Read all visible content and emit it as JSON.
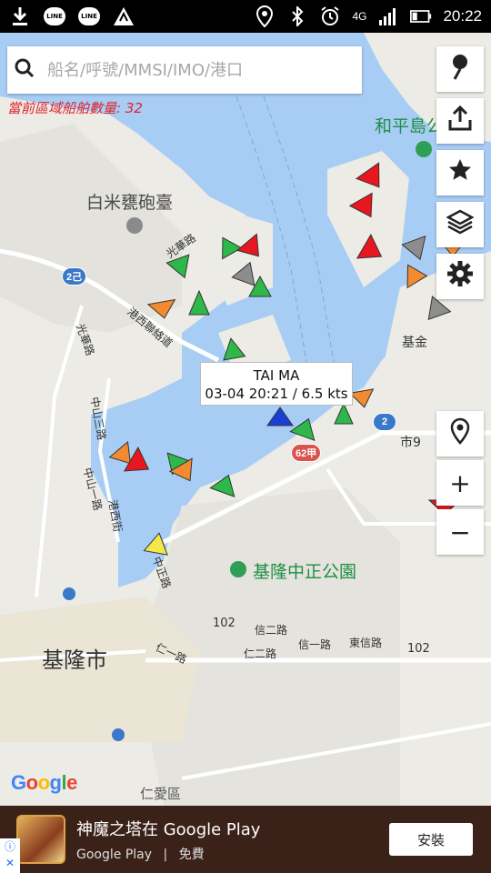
{
  "status_bar": {
    "time": "20:22",
    "network": "4G",
    "left_icons": [
      "download-icon",
      "line-icon",
      "line-icon",
      "app-icon"
    ],
    "line_label": "LINE",
    "right_icons": [
      "location-icon",
      "bluetooth-icon",
      "alarm-icon",
      "network-icon",
      "signal-icon",
      "battery-icon"
    ]
  },
  "search": {
    "placeholder": "船名/呼號/MMSI/IMO/港口",
    "icon": "search-icon"
  },
  "vessel_count": "當前區域船舶數量: 32",
  "map": {
    "labels": {
      "heping_island": "和平島公",
      "baimi_fort": "白米甕砲臺",
      "gangxi_road": "港西聯絡道",
      "guangfu_road": "光華路",
      "guangxi_road": "光華路",
      "zhongshan3": "中山三路",
      "zhongshan2": "中山一路",
      "gangxi_street": "港西街",
      "zhongzheng_park": "基隆中正公園",
      "keelung_city": "基隆市",
      "renai": "仁愛區",
      "xin2": "信二路",
      "xin1": "信一路",
      "dongxin": "東信路",
      "ren2": "仁二路",
      "ren1": "仁一路",
      "zhongzheng_road": "中正路",
      "jijin": "基金",
      "shi9": "市9",
      "r102a": "102",
      "r102b": "102"
    },
    "route_badges": {
      "r2c": "2己",
      "r2": "2",
      "r62": "62甲"
    }
  },
  "tooltip": {
    "vessel_name": "TAI MA",
    "info": "03-04 20:21 / 6.5 kts"
  },
  "buttons": {
    "pin_icon": "map-pin-icon",
    "share_icon": "share-icon",
    "favorite_icon": "star-icon",
    "layers_icon": "layers-icon",
    "settings_icon": "gear-icon",
    "locate_icon": "location-icon",
    "zoom_in": "+",
    "zoom_out": "−"
  },
  "attribution": "Google",
  "ad": {
    "title": "神魔之塔在 Google Play",
    "store": "Google Play",
    "separator": "|",
    "price": "免費",
    "install_label": "安裝"
  },
  "colors": {
    "water": "#a8cdf5",
    "land": "#ecebe6",
    "vessel_green": "#2fb84a",
    "vessel_red": "#e8161e",
    "vessel_orange": "#f28b30",
    "vessel_grey": "#8d8d8d",
    "vessel_blue": "#1b3fd6",
    "vessel_yellow": "#f3e84a",
    "count_red": "#e0232b"
  }
}
